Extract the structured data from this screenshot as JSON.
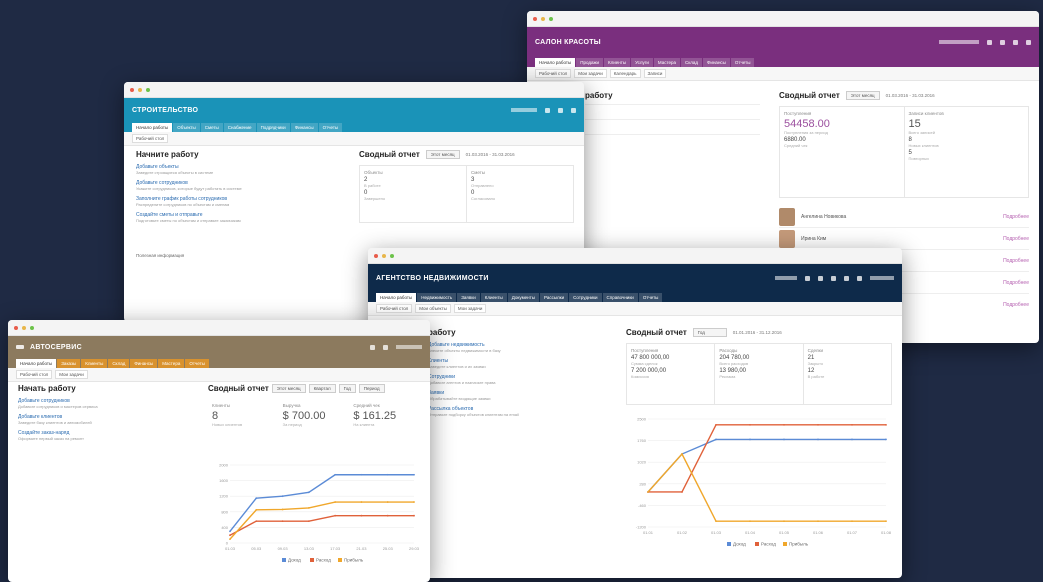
{
  "windows": {
    "salon": {
      "title": "САЛОН КРАСОТЫ",
      "accent": "#7a2f7e",
      "menu": [
        "Начало работы",
        "Продажи",
        "Клиенты",
        "Услуги",
        "Мастера",
        "Склад",
        "Финансы",
        "Отчеты"
      ],
      "sub_tab": "Рабочий стол",
      "sub_extra": [
        "Мои задачи",
        "Календарь",
        "Записи"
      ],
      "start_title": "работу",
      "summary_title": "Сводный отчет",
      "period_btn": "Этот месяц",
      "period": "01.03.2016 - 31.03.2016",
      "kpi": [
        {
          "label": "Поступления",
          "big": "54458.00",
          "cap": "Поступления за период",
          "mid": "6880.00",
          "cap2": "Средний чек"
        },
        {
          "label": "Записи клиентов",
          "big": "15",
          "cap": "Всего записей",
          "mid": "8",
          "cap2": "Новых клиентов",
          "mid2": "5",
          "cap3": "Повторных"
        }
      ],
      "staff": [
        "Ангелина Новикова",
        "Ирина Ким"
      ],
      "staff_link": "Подробнее"
    },
    "stroi": {
      "title": "СТРОИТЕЛЬСТВО",
      "accent": "#1a93b8",
      "menu": [
        "Начало работы",
        "Объекты",
        "Сметы",
        "Снабжение",
        "Подрядчики",
        "Финансы",
        "Отчеты"
      ],
      "sub_tab": "Рабочий стол",
      "start_title": "Начните работу",
      "summary_title": "Сводный отчет",
      "period_btn": "Этот месяц",
      "period": "01.03.2016 - 31.03.2016",
      "tasks": [
        {
          "link": "Добавьте объекты",
          "desc": "Заведите строящиеся объекты в системе"
        },
        {
          "link": "Добавьте сотрудников",
          "desc": "Укажите сотрудников, которые будут работать в системе"
        },
        {
          "link": "Заполните график работы сотрудников",
          "desc": "Распределите сотрудников по объектам и сменам"
        },
        {
          "link": "Создайте сметы и отправьте",
          "desc": "Подготовьте сметы по объектам и отправьте заказчикам"
        }
      ],
      "note": "Полезная информация",
      "kpi": [
        {
          "label": "Объекты",
          "big": "2",
          "cap": "В работе",
          "mid": "0",
          "cap2": "Завершено"
        },
        {
          "label": "Сметы",
          "big": "3",
          "cap": "Отправлено",
          "mid": "0",
          "cap2": "Согласовано"
        }
      ]
    },
    "agency": {
      "title": "АГЕНТСТВО НЕДВИЖИМОСТИ",
      "accent": "#0e2a4a",
      "menu": [
        "Начало работы",
        "Недвижимость",
        "Заявки",
        "Клиенты",
        "Документы",
        "Рассылки",
        "Сотрудники",
        "Справочники",
        "Отчеты"
      ],
      "sub_tab": "Рабочий стол",
      "sub_extra": [
        "Мои объекты",
        "Мои задачи"
      ],
      "start_title": "работу",
      "summary_title": "Сводный отчет",
      "period_btn": "Год",
      "period": "01.01.2016 - 31.12.2016",
      "tasks": [
        {
          "link": "Добавьте недвижимость",
          "desc": "Внесите объекты недвижимости в базу"
        },
        {
          "link": "Клиенты",
          "desc": "Заведите клиентов и их заявки"
        },
        {
          "link": "Сотрудники",
          "desc": "Добавьте агентов и назначьте права"
        },
        {
          "link": "Заявки",
          "desc": "Обрабатывайте входящие заявки"
        },
        {
          "link": "Рассылка объектов",
          "desc": "Отправьте подборку объектов клиентам на email"
        }
      ],
      "kpi": [
        {
          "label": "Поступления",
          "big": "47 800 000,00",
          "cap": "Сумма сделок",
          "mid": "7 200 000,00",
          "cap2": "Комиссия"
        },
        {
          "label": "Расходы",
          "big": "204 780,00",
          "cap": "Всего расходов",
          "mid": "13 980,00",
          "cap2": "Реклама"
        },
        {
          "label": "Сделки",
          "big": "21",
          "cap": "Закрыто",
          "mid": "12",
          "cap2": "В работе"
        }
      ],
      "legend": [
        "Доход",
        "Расход",
        "Прибыль"
      ]
    },
    "auto": {
      "title": "АВТОСЕРВИС",
      "accent": "#8c7a5e",
      "menu": [
        "Начало работы",
        "Заказы",
        "Клиенты",
        "Склад",
        "Финансы",
        "Мастера",
        "Отчеты"
      ],
      "sub_tab": "Рабочий стол",
      "sub_extra": [
        "Мои задачи"
      ],
      "start_title": "Начать работу",
      "summary_title": "Сводный отчет",
      "period_btn": "Этот месяц",
      "period_btns": [
        "Квартал",
        "Год",
        "Период"
      ],
      "tasks": [
        {
          "link": "Добавьте сотрудников",
          "desc": "Добавьте сотрудников и мастеров сервиса"
        },
        {
          "link": "Добавьте клиентов",
          "desc": "Заведите базу клиентов и автомобилей"
        },
        {
          "link": "Создайте заказ-наряд",
          "desc": "Оформите первый заказ на ремонт"
        }
      ],
      "kpi": [
        {
          "label": "Клиенты",
          "big": "8",
          "cap": "Новых клиентов"
        },
        {
          "label": "Выручка",
          "big": "$ 700.00",
          "cap": "За период"
        },
        {
          "label": "Средний чек",
          "big": "$ 161.25",
          "cap": "На клиента"
        }
      ],
      "legend": [
        "Доход",
        "Расход",
        "Прибыль"
      ]
    }
  },
  "chart_data": [
    {
      "type": "line",
      "title": "",
      "x": [
        "01.03",
        "05.03",
        "09.03",
        "13.03",
        "17.03",
        "21.03",
        "25.03",
        "29.03"
      ],
      "series": [
        {
          "name": "Доход",
          "values": [
            300,
            1150,
            1200,
            1300,
            1750,
            1750,
            1750,
            1750
          ]
        },
        {
          "name": "Расход",
          "values": [
            200,
            560,
            560,
            560,
            700,
            700,
            700,
            700
          ]
        },
        {
          "name": "Прибыль",
          "values": [
            100,
            850,
            860,
            900,
            1050,
            1050,
            1050,
            1050
          ]
        }
      ],
      "ylim": [
        0,
        2000
      ]
    },
    {
      "type": "line",
      "title": "",
      "x": [
        "01.01",
        "01.02",
        "01.03",
        "01.04",
        "01.05",
        "01.06",
        "01.07",
        "01.08"
      ],
      "series": [
        {
          "name": "Доход",
          "values": [
            0,
            1300,
            1800,
            1800,
            1800,
            1800,
            1800,
            1800
          ]
        },
        {
          "name": "Расход",
          "values": [
            0,
            0,
            2300,
            2300,
            2300,
            2300,
            2300,
            2300
          ]
        },
        {
          "name": "Прибыль",
          "values": [
            0,
            1300,
            -1000,
            -1000,
            -1000,
            -1000,
            -1000,
            -1000
          ]
        }
      ],
      "ylim": [
        -1200,
        2500
      ]
    }
  ],
  "colors": {
    "income": "#5b8bd6",
    "expense": "#e0613a",
    "profit": "#f0a72b"
  }
}
